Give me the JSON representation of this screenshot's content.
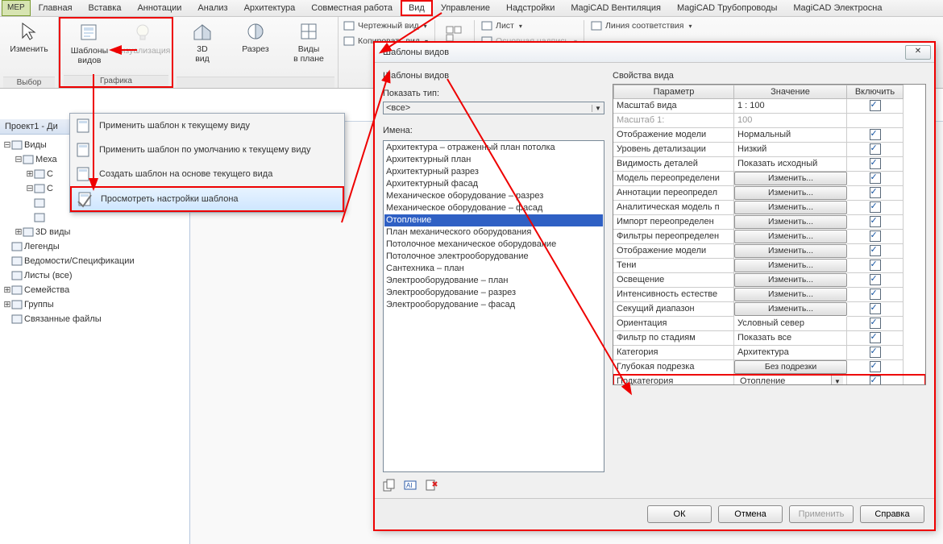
{
  "menu": {
    "items": [
      "MEP",
      "Главная",
      "Вставка",
      "Аннотации",
      "Анализ",
      "Архитектура",
      "Совместная работа",
      "Вид",
      "Управление",
      "Надстройки",
      "MagiCAD Вентиляция",
      "MagiCAD Трубопроводы",
      "MagiCAD Электросна"
    ],
    "active": "Вид"
  },
  "ribbon": {
    "p0": {
      "title": "Выбор",
      "b0": "Изменить"
    },
    "p1": {
      "title": "Графика",
      "b0": "Шаблоны\nвидов",
      "b1": "Визуализация"
    },
    "p2": {
      "title": "",
      "b0": "3D\nвид",
      "b1": "Разрез",
      "b2": "Виды\nв плане"
    },
    "small1": [
      {
        "icon": "draft",
        "label": "Чертежный вид"
      },
      {
        "icon": "copy",
        "label": "Копировать вид"
      }
    ],
    "small2": [
      {
        "icon": "sheet",
        "label": "Лист"
      },
      {
        "icon": "title",
        "label": "Основная надпись",
        "dis": true
      }
    ],
    "small3": [
      {
        "icon": "match",
        "label": "Линия соответствия"
      }
    ]
  },
  "browser": {
    "title": "Проект1 - Ди",
    "nodes": [
      {
        "lvl": 0,
        "exp": "-",
        "icon": "views",
        "label": "Виды"
      },
      {
        "lvl": 1,
        "exp": "-",
        "icon": "",
        "label": "Меха"
      },
      {
        "lvl": 2,
        "exp": "+",
        "icon": "",
        "label": "С"
      },
      {
        "lvl": 2,
        "exp": "-",
        "icon": "",
        "label": "С"
      },
      {
        "lvl": 2,
        "exp": "",
        "icon": "",
        "label": ""
      },
      {
        "lvl": 2,
        "exp": "",
        "icon": "",
        "label": ""
      },
      {
        "lvl": 1,
        "exp": "+",
        "icon": "",
        "label": "3D виды"
      },
      {
        "lvl": 0,
        "exp": "",
        "icon": "leg",
        "label": "Легенды"
      },
      {
        "lvl": 0,
        "exp": "",
        "icon": "sched",
        "label": "Ведомости/Спецификации"
      },
      {
        "lvl": 0,
        "exp": "",
        "icon": "sheet",
        "label": "Листы (все)"
      },
      {
        "lvl": 0,
        "exp": "+",
        "icon": "fam",
        "label": "Семейства"
      },
      {
        "lvl": 0,
        "exp": "+",
        "icon": "grp",
        "label": "Группы"
      },
      {
        "lvl": 0,
        "exp": "",
        "icon": "link",
        "label": "Связанные файлы"
      }
    ]
  },
  "ctx": {
    "items": [
      "Применить шаблон к текущему виду",
      "Применить шаблон по умолчанию к текущему виду",
      "Создать шаблон на основе текущего вида",
      "Просмотреть настройки шаблона"
    ]
  },
  "dlg": {
    "title": "Шаблоны видов",
    "left_group": "Шаблоны видов",
    "show_type": "Показать тип:",
    "show_type_val": "<все>",
    "names_lbl": "Имена:",
    "names": [
      "Архитектура – отраженный план потолка",
      "Архитектурный план",
      "Архитектурный разрез",
      "Архитектурный фасад",
      "Механическое оборудование – разрез",
      "Механическое оборудование – фасад",
      "Отопление",
      "План механического оборудования",
      "Потолочное механическое оборудование",
      "Потолочное электрооборудование",
      "Сантехника – план",
      "Электрооборудование – план",
      "Электрооборудование – разрез",
      "Электрооборудование – фасад"
    ],
    "names_sel": 6,
    "right_group": "Свойства вида",
    "h0": "Параметр",
    "h1": "Значение",
    "h2": "Включить",
    "rows": [
      {
        "p": "Масштаб вида",
        "v": "1 : 100",
        "t": "text",
        "on": true
      },
      {
        "p": "Масштаб  1:",
        "v": "100",
        "t": "text",
        "on": false,
        "dis": true
      },
      {
        "p": "Отображение модели",
        "v": "Нормальный",
        "t": "text",
        "on": true
      },
      {
        "p": "Уровень детализации",
        "v": "Низкий",
        "t": "text",
        "on": true
      },
      {
        "p": "Видимость деталей",
        "v": "Показать исходный",
        "t": "text",
        "on": true
      },
      {
        "p": "Модель переопределени",
        "v": "Изменить...",
        "t": "btn",
        "on": true
      },
      {
        "p": "Аннотации переопредел",
        "v": "Изменить...",
        "t": "btn",
        "on": true
      },
      {
        "p": "Аналитическая модель п",
        "v": "Изменить...",
        "t": "btn",
        "on": true
      },
      {
        "p": "Импорт переопределен",
        "v": "Изменить...",
        "t": "btn",
        "on": true
      },
      {
        "p": "Фильтры переопределен",
        "v": "Изменить...",
        "t": "btn",
        "on": true
      },
      {
        "p": "Отображение модели",
        "v": "Изменить...",
        "t": "btn",
        "on": true
      },
      {
        "p": "Тени",
        "v": "Изменить...",
        "t": "btn",
        "on": true
      },
      {
        "p": "Освещение",
        "v": "Изменить...",
        "t": "btn",
        "on": true
      },
      {
        "p": "Интенсивность естестве",
        "v": "Изменить...",
        "t": "btn",
        "on": true
      },
      {
        "p": "Секущий диапазон",
        "v": "Изменить...",
        "t": "btn",
        "on": true
      },
      {
        "p": "Ориентация",
        "v": "Условный север",
        "t": "text",
        "on": true
      },
      {
        "p": "Фильтр по стадиям",
        "v": "Показать все",
        "t": "text",
        "on": true
      },
      {
        "p": "Категория",
        "v": "Архитектура",
        "t": "text",
        "on": true
      },
      {
        "p": "Глубокая подрезка",
        "v": "Без подрезки",
        "t": "btn",
        "on": true
      },
      {
        "p": "Подкатегория",
        "v": "Отопление",
        "t": "combo",
        "on": true,
        "hl": true
      }
    ],
    "btn_ok": "ОК",
    "btn_cancel": "Отмена",
    "btn_apply": "Применить",
    "btn_help": "Справка"
  }
}
